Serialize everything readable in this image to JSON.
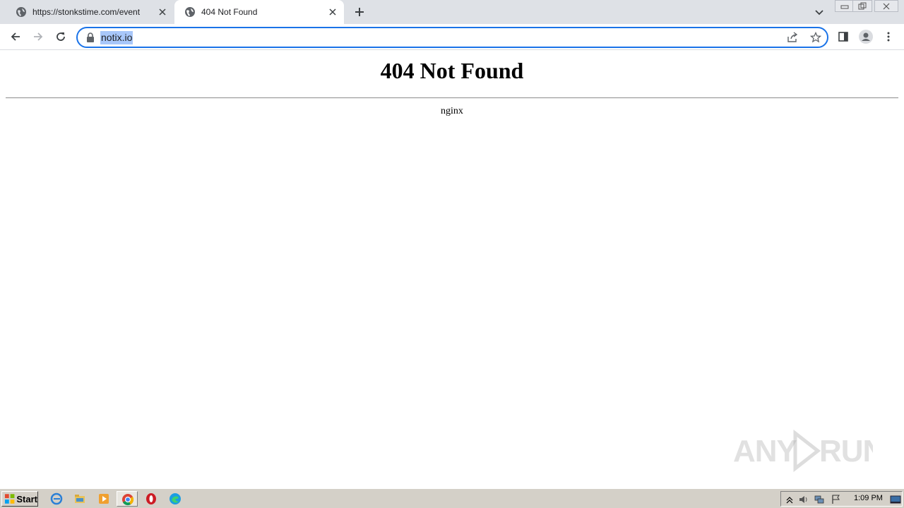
{
  "browser": {
    "tabs": [
      {
        "title": "https://stonkstime.com/event",
        "active": false
      },
      {
        "title": "404 Not Found",
        "active": true
      }
    ],
    "address_bar": {
      "value": "notix.io",
      "selected": true
    }
  },
  "page": {
    "heading": "404 Not Found",
    "server": "nginx"
  },
  "watermark": {
    "text": "ANY RUN"
  },
  "taskbar": {
    "start_label": "Start",
    "clock": "1:09 PM",
    "pinned_icons": [
      "internet-explorer-icon",
      "file-explorer-icon",
      "media-player-icon",
      "chrome-icon",
      "opera-icon",
      "edge-icon"
    ]
  },
  "colors": {
    "accent": "#1a73e8",
    "tabstrip": "#dee1e6",
    "taskbar": "#d4d0c8"
  }
}
